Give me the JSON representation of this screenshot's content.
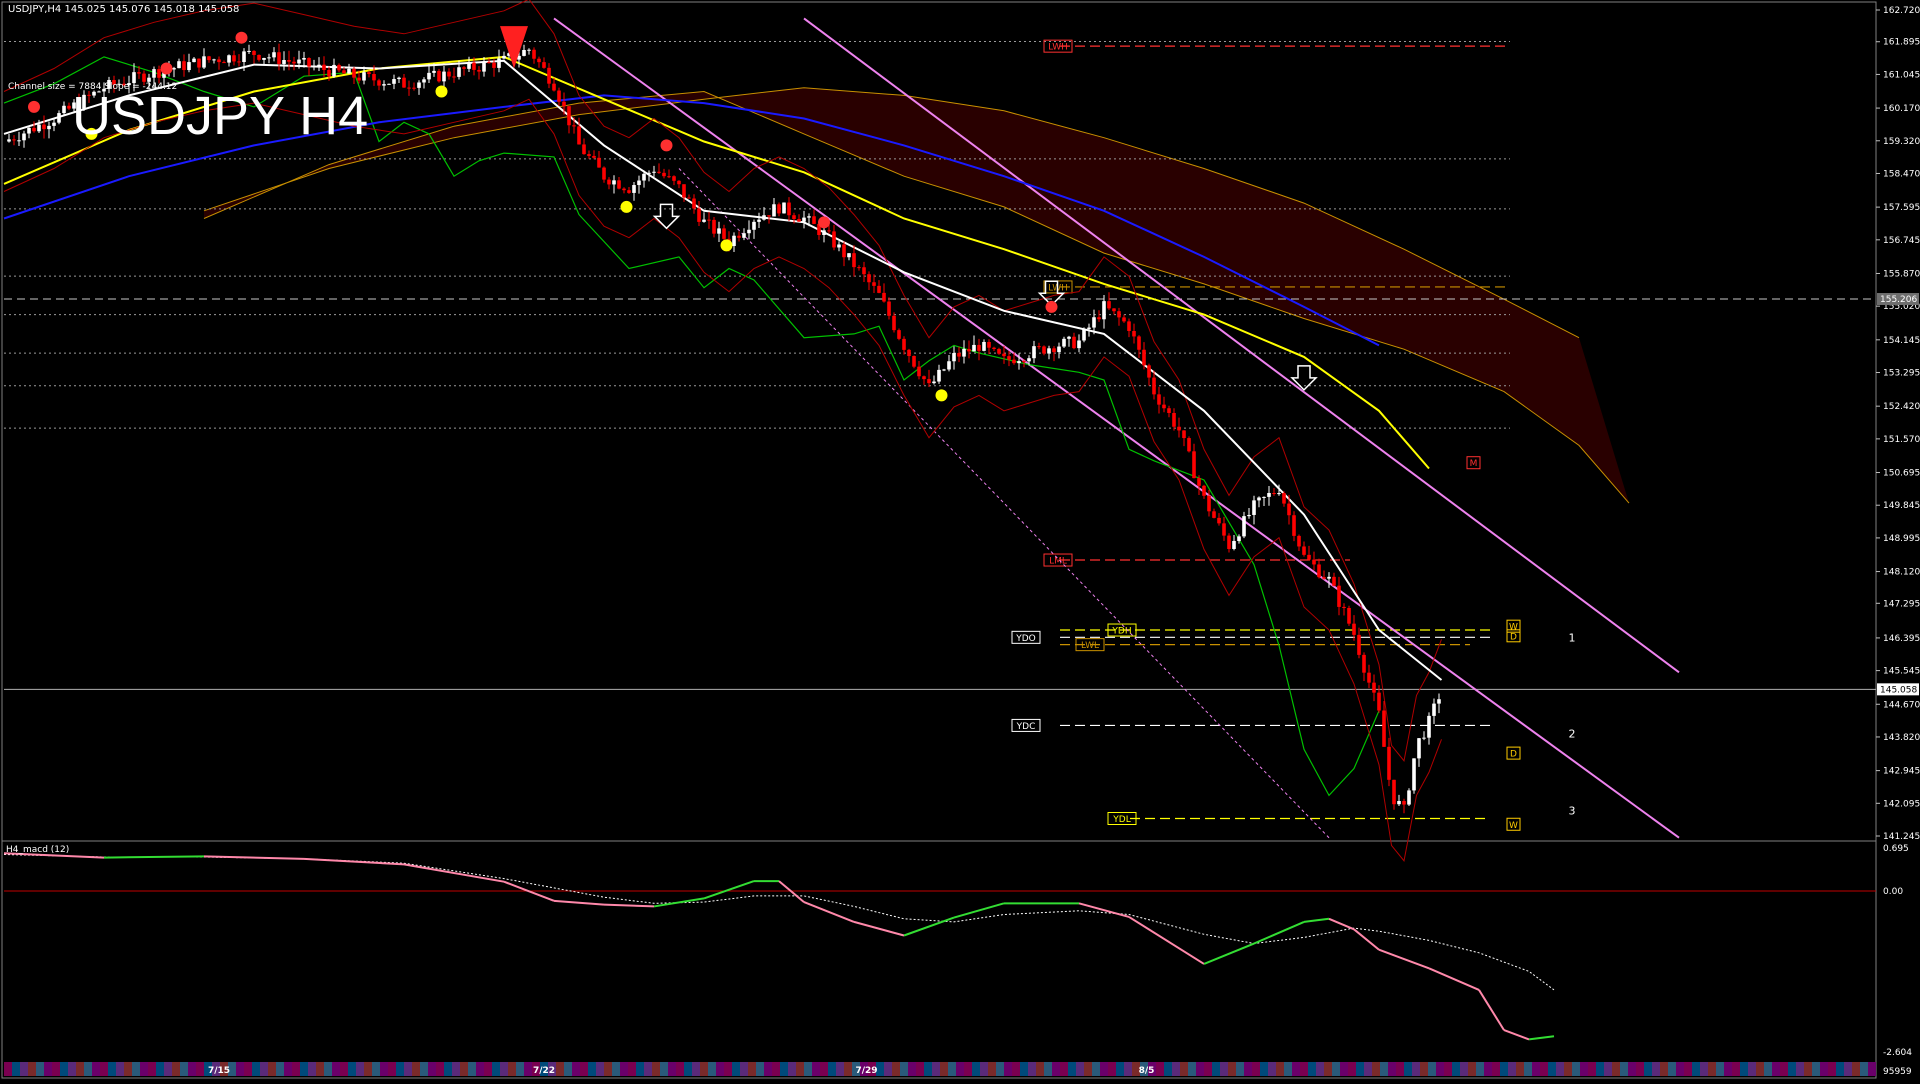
{
  "window": {
    "ohlc_header": "USDJPY,H4  145.025 145.076 145.018 145.058",
    "big_title": "USDJPY H4",
    "channel_info": "Channel size = 7884 Slope = -244.12"
  },
  "colors": {
    "background": "#000000",
    "bull_candle": "#ffffff",
    "bear_candle": "#ff0000",
    "ma_white": "#ffffff",
    "ma_yellow": "#ffff00",
    "ma_blue": "#1a1aff",
    "chikou_green": "#00c000",
    "channel_violet": "#ee82ee",
    "cloud_orange": "#c89000",
    "cloud_red": "#c00000",
    "macd_up": "#33dd33",
    "macd_down": "#ff88aa"
  },
  "chart_data": [
    {
      "type": "candlestick",
      "symbol": "USDJPY",
      "timeframe": "H4",
      "last_price": "145.058",
      "ylim": [
        141.245,
        162.72
      ],
      "price_axis": [
        "162.720",
        "161.895",
        "161.045",
        "160.170",
        "159.320",
        "158.470",
        "157.595",
        "156.745",
        "155.870",
        "155.020",
        "154.145",
        "153.295",
        "152.420",
        "151.570",
        "150.695",
        "149.845",
        "148.995",
        "148.120",
        "147.295",
        "146.395",
        "145.545",
        "144.670",
        "143.820",
        "142.945",
        "142.095",
        "141.245"
      ],
      "current_price_tag": "145.058",
      "dashed_tag": "155.206",
      "date_labels": [
        "7/15",
        "7/22",
        "7/29",
        "8/5"
      ],
      "close_path": [
        [
          0,
          159.3
        ],
        [
          40,
          159.9
        ],
        [
          80,
          160.7
        ],
        [
          120,
          161.1
        ],
        [
          160,
          161.4
        ],
        [
          200,
          161.6
        ],
        [
          240,
          161.3
        ],
        [
          280,
          161.0
        ],
        [
          320,
          160.8
        ],
        [
          360,
          161.1
        ],
        [
          400,
          161.4
        ],
        [
          420,
          161.7
        ],
        [
          440,
          160.8
        ],
        [
          460,
          159.2
        ],
        [
          480,
          158.4
        ],
        [
          500,
          158.1
        ],
        [
          520,
          158.6
        ],
        [
          540,
          158.1
        ],
        [
          560,
          157.2
        ],
        [
          580,
          156.7
        ],
        [
          600,
          157.3
        ],
        [
          620,
          157.6
        ],
        [
          640,
          157.3
        ],
        [
          660,
          156.8
        ],
        [
          680,
          156.1
        ],
        [
          700,
          155.3
        ],
        [
          720,
          154.0
        ],
        [
          740,
          152.9
        ],
        [
          760,
          153.7
        ],
        [
          780,
          154.0
        ],
        [
          800,
          153.6
        ],
        [
          820,
          153.8
        ],
        [
          840,
          154.0
        ],
        [
          860,
          154.1
        ],
        [
          880,
          155.0
        ],
        [
          900,
          154.5
        ],
        [
          920,
          152.8
        ],
        [
          940,
          151.8
        ],
        [
          960,
          150.0
        ],
        [
          980,
          148.8
        ],
        [
          1000,
          149.8
        ],
        [
          1020,
          150.3
        ],
        [
          1040,
          148.5
        ],
        [
          1060,
          147.9
        ],
        [
          1080,
          146.5
        ],
        [
          1100,
          144.4
        ],
        [
          1110,
          142.3
        ],
        [
          1120,
          141.9
        ],
        [
          1130,
          143.6
        ],
        [
          1140,
          144.2
        ],
        [
          1150,
          145.06
        ]
      ],
      "chikou_path": [
        [
          0,
          160.3
        ],
        [
          40,
          160.8
        ],
        [
          80,
          161.5
        ],
        [
          120,
          161.1
        ],
        [
          160,
          160.6
        ],
        [
          200,
          160.2
        ],
        [
          240,
          161.0
        ],
        [
          280,
          161.1
        ],
        [
          300,
          159.3
        ],
        [
          320,
          159.8
        ],
        [
          340,
          159.5
        ],
        [
          360,
          158.4
        ],
        [
          380,
          158.8
        ],
        [
          400,
          159.0
        ],
        [
          440,
          158.9
        ],
        [
          460,
          157.4
        ],
        [
          500,
          156.0
        ],
        [
          540,
          156.3
        ],
        [
          560,
          155.5
        ],
        [
          580,
          156.0
        ],
        [
          600,
          155.7
        ],
        [
          640,
          154.2
        ],
        [
          680,
          154.3
        ],
        [
          700,
          154.5
        ],
        [
          720,
          153.1
        ],
        [
          740,
          153.6
        ],
        [
          760,
          154.0
        ],
        [
          780,
          153.8
        ],
        [
          820,
          153.5
        ],
        [
          860,
          153.3
        ],
        [
          880,
          153.1
        ],
        [
          900,
          151.3
        ],
        [
          920,
          151.0
        ],
        [
          960,
          150.5
        ],
        [
          1000,
          148.3
        ],
        [
          1020,
          146.2
        ],
        [
          1040,
          143.5
        ],
        [
          1060,
          142.3
        ],
        [
          1080,
          143.0
        ],
        [
          1100,
          144.5
        ]
      ],
      "lines": {
        "white_ma": [
          [
            0,
            159.5
          ],
          [
            100,
            160.5
          ],
          [
            200,
            161.3
          ],
          [
            300,
            161.2
          ],
          [
            400,
            161.4
          ],
          [
            480,
            159.2
          ],
          [
            560,
            157.5
          ],
          [
            640,
            157.2
          ],
          [
            720,
            155.9
          ],
          [
            800,
            154.9
          ],
          [
            880,
            154.3
          ],
          [
            960,
            152.3
          ],
          [
            1040,
            149.6
          ],
          [
            1100,
            146.6
          ],
          [
            1150,
            145.3
          ]
        ],
        "yellow_ma": [
          [
            0,
            158.2
          ],
          [
            100,
            159.6
          ],
          [
            200,
            160.6
          ],
          [
            300,
            161.2
          ],
          [
            400,
            161.5
          ],
          [
            480,
            160.4
          ],
          [
            560,
            159.3
          ],
          [
            640,
            158.5
          ],
          [
            720,
            157.3
          ],
          [
            800,
            156.5
          ],
          [
            880,
            155.6
          ],
          [
            960,
            154.8
          ],
          [
            1040,
            153.7
          ],
          [
            1100,
            152.3
          ],
          [
            1140,
            150.8
          ]
        ],
        "blue_ma": [
          [
            0,
            157.3
          ],
          [
            100,
            158.4
          ],
          [
            200,
            159.2
          ],
          [
            300,
            159.8
          ],
          [
            400,
            160.2
          ],
          [
            480,
            160.5
          ],
          [
            560,
            160.3
          ],
          [
            640,
            159.9
          ],
          [
            720,
            159.2
          ],
          [
            800,
            158.4
          ],
          [
            880,
            157.5
          ],
          [
            960,
            156.3
          ],
          [
            1040,
            155.0
          ],
          [
            1100,
            154.0
          ]
        ]
      },
      "channels": [
        {
          "from": [
            440,
            162.5
          ],
          "to": [
            1340,
            141.2
          ]
        },
        {
          "from": [
            640,
            162.5
          ],
          "to": [
            1340,
            145.5
          ]
        },
        {
          "from": [
            540,
            158.6
          ],
          "to": [
            1060,
            141.2
          ]
        }
      ],
      "levels": [
        {
          "label": "LWH",
          "price": "161.78",
          "color": "#ff3030",
          "tag_style": "outline"
        },
        {
          "label": "LWH",
          "price": "155.52",
          "color": "#c89000",
          "tag_style": "outline"
        },
        {
          "label": "LML",
          "price": "148.42",
          "color": "#ff3030",
          "tag_style": "outline"
        },
        {
          "label": "YDH",
          "price": "146.60",
          "color": "#ffff00",
          "tag_style": "outline"
        },
        {
          "label": "YDO",
          "price": "146.41",
          "color": "#ffffff",
          "tag_style": "box"
        },
        {
          "label": "LWL",
          "price": "146.22",
          "color": "#c89000",
          "tag_style": "outline"
        },
        {
          "label": "YDC",
          "price": "144.12",
          "color": "#ffffff",
          "tag_style": "box"
        },
        {
          "label": "YDL",
          "price": "141.70",
          "color": "#ffff00",
          "tag_style": "outline"
        }
      ],
      "small_tags": [
        "W",
        "D",
        "D",
        "W",
        "M"
      ],
      "target_numbers": [
        "1",
        "2",
        "3"
      ]
    },
    {
      "type": "line",
      "title": "H4_macd (12)",
      "axis_labels": [
        "0.695",
        "0.00",
        "-2.604",
        "95959"
      ],
      "ylim": [
        -2.604,
        0.695
      ],
      "macd": [
        [
          0,
          0.61
        ],
        [
          80,
          0.54
        ],
        [
          160,
          0.56
        ],
        [
          240,
          0.52
        ],
        [
          320,
          0.43
        ],
        [
          400,
          0.15
        ],
        [
          440,
          -0.16
        ],
        [
          480,
          -0.22
        ],
        [
          520,
          -0.25
        ],
        [
          560,
          -0.12
        ],
        [
          600,
          0.16
        ],
        [
          620,
          0.16
        ],
        [
          640,
          -0.18
        ],
        [
          680,
          -0.5
        ],
        [
          720,
          -0.72
        ],
        [
          760,
          -0.43
        ],
        [
          800,
          -0.2
        ],
        [
          860,
          -0.2
        ],
        [
          900,
          -0.42
        ],
        [
          960,
          -1.18
        ],
        [
          1000,
          -0.85
        ],
        [
          1040,
          -0.5
        ],
        [
          1060,
          -0.45
        ],
        [
          1080,
          -0.62
        ],
        [
          1100,
          -0.95
        ],
        [
          1140,
          -1.25
        ],
        [
          1180,
          -1.6
        ],
        [
          1200,
          -2.25
        ],
        [
          1220,
          -2.4
        ],
        [
          1240,
          -2.35
        ]
      ],
      "signal": [
        [
          0,
          0.59
        ],
        [
          80,
          0.55
        ],
        [
          160,
          0.55
        ],
        [
          240,
          0.52
        ],
        [
          320,
          0.45
        ],
        [
          400,
          0.2
        ],
        [
          440,
          0.05
        ],
        [
          480,
          -0.1
        ],
        [
          520,
          -0.2
        ],
        [
          560,
          -0.18
        ],
        [
          600,
          -0.08
        ],
        [
          640,
          -0.08
        ],
        [
          680,
          -0.25
        ],
        [
          720,
          -0.45
        ],
        [
          760,
          -0.5
        ],
        [
          800,
          -0.38
        ],
        [
          860,
          -0.32
        ],
        [
          900,
          -0.38
        ],
        [
          960,
          -0.7
        ],
        [
          1000,
          -0.85
        ],
        [
          1040,
          -0.75
        ],
        [
          1080,
          -0.6
        ],
        [
          1100,
          -0.65
        ],
        [
          1140,
          -0.8
        ],
        [
          1180,
          -1.0
        ],
        [
          1220,
          -1.3
        ],
        [
          1240,
          -1.6
        ]
      ]
    }
  ]
}
